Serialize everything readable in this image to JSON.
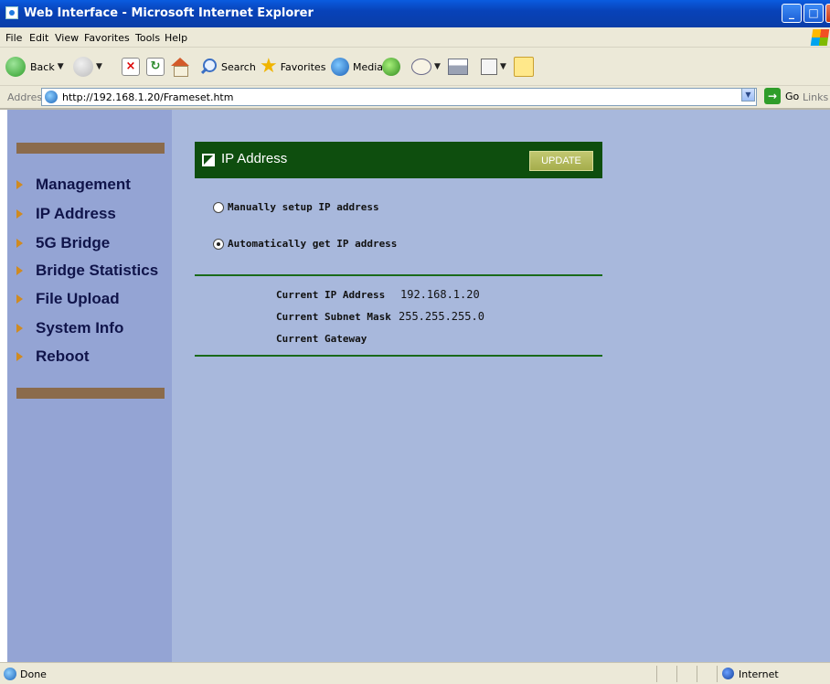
{
  "window": {
    "title": "Web Interface - Microsoft Internet Explorer"
  },
  "menubar": {
    "items": [
      "File",
      "Edit",
      "View",
      "Favorites",
      "Tools",
      "Help"
    ]
  },
  "toolbar": {
    "back_label": "Back",
    "search_label": "Search",
    "favorites_label": "Favorites",
    "media_label": "Media"
  },
  "addressbar": {
    "label": "Address",
    "url": "http://192.168.1.20/Frameset.htm",
    "go_label": "Go",
    "links_label": "Links"
  },
  "sidebar": {
    "items": [
      {
        "label": "Management"
      },
      {
        "label": "IP Address"
      },
      {
        "label": "5G Bridge"
      },
      {
        "label": "Bridge Statistics"
      },
      {
        "label": "File Upload"
      },
      {
        "label": "System Info"
      },
      {
        "label": "Reboot"
      }
    ]
  },
  "panel": {
    "title": "IP Address",
    "update_label": "UPDATE",
    "options": [
      {
        "label": "Manually setup IP address",
        "checked": false
      },
      {
        "label": "Automatically get IP address",
        "checked": true
      }
    ],
    "info": [
      {
        "label": "Current IP Address",
        "value": "192.168.1.20"
      },
      {
        "label": "Current Subnet Mask",
        "value": "255.255.255.0"
      },
      {
        "label": "Current Gateway",
        "value": ""
      }
    ]
  },
  "statusbar": {
    "status": "Done",
    "zone": "Internet"
  },
  "colors": {
    "sidebar_bg": "#94a4d4",
    "main_bg": "#a8b8dc",
    "panel_header": "#0e4e0e",
    "nav_bullet": "#d08a20",
    "bar_brown": "#8b6b4c"
  }
}
